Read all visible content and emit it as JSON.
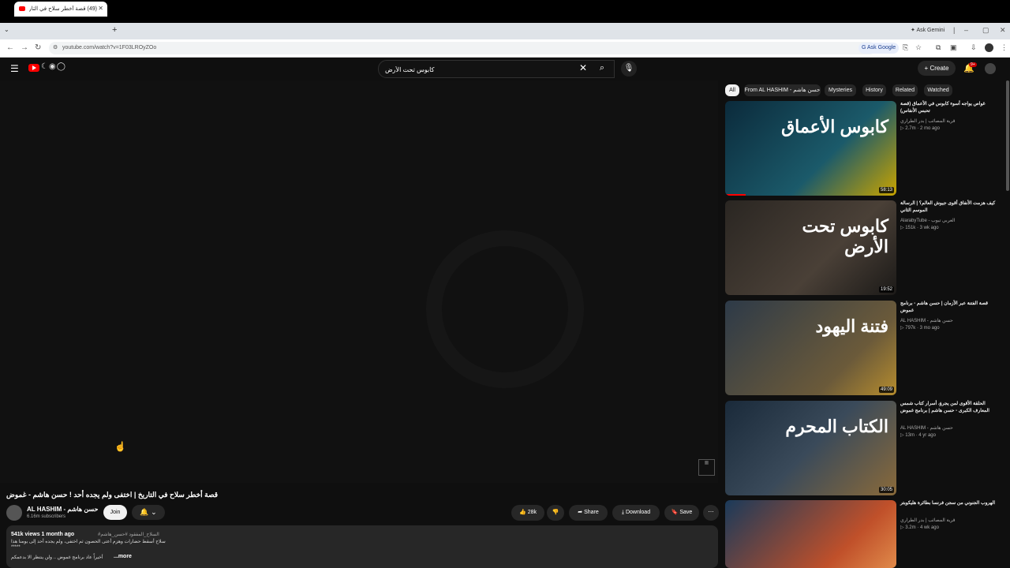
{
  "browser": {
    "tab_title": "(49) قصة أخطر سلاح في التاريخ",
    "url": "youtube.com/watch?v=1F03LROyZOo",
    "ask_gemini": "Ask Gemini",
    "ask_google": "Ask Google"
  },
  "header": {
    "search_value": "كابوس تحت الأرض",
    "create_label": "Create",
    "notif_count": "9+"
  },
  "video": {
    "title": "قصة أخطر سلاح في التاريخ | اختفى ولم يجده أحد ! حسن هاشم - غموض",
    "channel": "AL HASHIM - حسن هاشم",
    "subscribers": "6.16m subscribers",
    "join_label": "Join",
    "likes": "28k",
    "share_label": "Share",
    "download_label": "Download",
    "save_label": "Save",
    "views_line": "541k views  1 month ago",
    "tags": "#السلاح_المفقود #حسن_هاشم",
    "desc_line1": "سلاح أسقط حضارات وهزم أعتى الحصون ثم اختفى، ولم يجده أحد إلى يومنا هذا",
    "desc_line2": "*****",
    "desc_line3": "أخيراً عاد برنامج غموض .. ولن ينتظر الا بدعمكم",
    "more_label": "...more"
  },
  "chips": [
    {
      "label": "All",
      "active": true
    },
    {
      "label": "From AL HASHIM - حسن هاشم",
      "active": false
    },
    {
      "label": "Mysteries",
      "active": false
    },
    {
      "label": "History",
      "active": false
    },
    {
      "label": "Related",
      "active": false
    },
    {
      "label": "Watched",
      "active": false
    }
  ],
  "recommendations": [
    {
      "title": "غواص يواجه أسوء كابوس في الأعماق (قصة تحبس الأنفاس)",
      "channel": "قرية المصائب | بدر الطراري",
      "meta": "▷ 2.7m · 2 mo ago",
      "duration": "58:13",
      "thumb_text": "كابوس الأعماق",
      "progress": 0.12
    },
    {
      "title": "كيف هزمت الأنفاق أقوى جيوش العالم؟ | الرسالة الموسم الثاني",
      "channel": "AlarabyTube - العربي تيوب",
      "meta": "▷ 151k · 3 wk ago",
      "duration": "19:52",
      "thumb_text": "كابوس تحت الأرض",
      "progress": 0
    },
    {
      "title": "قصة الفتنة عبر الأزمان | حسن هاشم - برنامج غموض",
      "channel": "AL HASHIM - حسن هاشم",
      "meta": "▷ 797k · 3 mo ago",
      "duration": "49:09",
      "thumb_text": "فتنة اليهود",
      "progress": 0
    },
    {
      "title": "الحلقة الأقوى لمن يجرؤ، أسرار كتاب شمس المعارف الكبرى - حسن هاشم | برنامج غموض",
      "channel": "AL HASHIM - حسن هاشم",
      "meta": "▷ 13m · 4 yr ago",
      "duration": "30:05",
      "thumb_text": "الكتاب المحرم",
      "progress": 0
    },
    {
      "title": "الهروب الجنوني من سجن فرنسا بطائرة هليكوبتر",
      "channel": "قرية المصائب | بدر الطراري",
      "meta": "▷ 3.2m · 4 wk ago",
      "duration": "",
      "thumb_text": "",
      "progress": 0
    }
  ],
  "colors": {
    "bg": "#0f0f0f",
    "accent": "#ff0000",
    "surface": "#272727"
  }
}
